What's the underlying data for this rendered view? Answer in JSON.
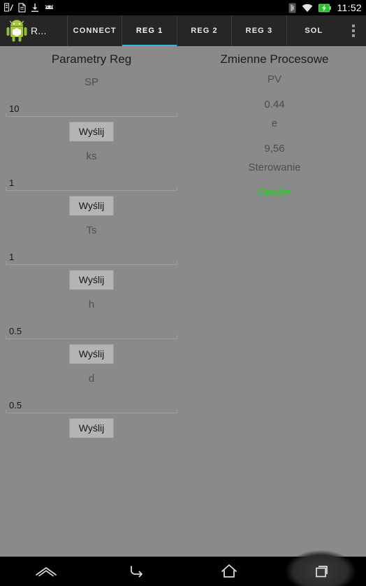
{
  "statusbar": {
    "time": "11:52",
    "left_icons": [
      "usb-debug-icon",
      "document-icon",
      "download-icon",
      "android-head-icon"
    ],
    "right_icons": [
      "bluetooth-icon",
      "wifi-icon",
      "battery-charging-icon"
    ]
  },
  "actionbar": {
    "app_icon": "android-robot-icon",
    "title": "R...",
    "overflow_icon": "overflow-menu-icon",
    "tabs": [
      {
        "label": "CONNECT",
        "active": false
      },
      {
        "label": "REG 1",
        "active": true
      },
      {
        "label": "REG 2",
        "active": false
      },
      {
        "label": "REG 3",
        "active": false
      },
      {
        "label": "SOL",
        "active": false
      }
    ],
    "active_tab_color": "#33b5e5"
  },
  "left_pane": {
    "title": "Parametry Reg",
    "fields": [
      {
        "label": "SP",
        "value": "10",
        "button": "Wyślij"
      },
      {
        "label": "ks",
        "value": "1",
        "button": "Wyślij"
      },
      {
        "label": "Ts",
        "value": "1",
        "button": "Wyślij"
      },
      {
        "label": "h",
        "value": "0.5",
        "button": "Wyślij"
      },
      {
        "label": "d",
        "value": "0.5",
        "button": "Wyślij"
      }
    ]
  },
  "right_pane": {
    "title": "Zmienne Procesowe",
    "readouts": [
      {
        "label": "PV",
        "value": "0.44",
        "color": "#4b4b4b"
      },
      {
        "label": "e",
        "value": "9,56",
        "color": "#4b4b4b"
      },
      {
        "label": "Sterowanie",
        "value": "Otwórz",
        "color": "#0ae00a"
      }
    ]
  },
  "navbar": {
    "buttons": [
      "menu-chevron-icon",
      "back-icon",
      "home-icon",
      "recents-icon"
    ]
  }
}
